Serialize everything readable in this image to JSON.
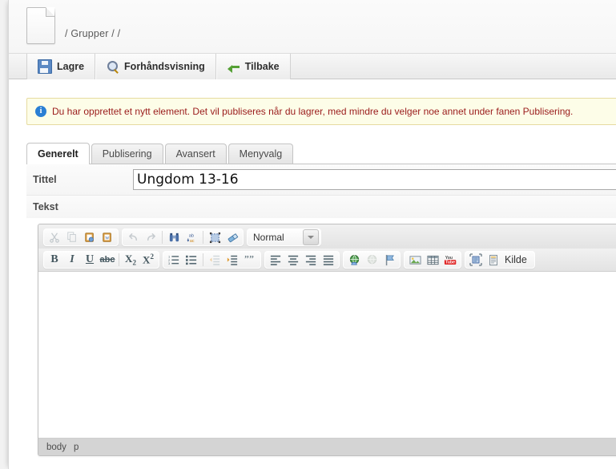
{
  "header": {
    "doc_icon": "page-document-icon",
    "breadcrumb": "/ Grupper / /"
  },
  "command_bar": {
    "buttons": [
      {
        "label": "Lagre",
        "icon": "floppy-disk-save-icon"
      },
      {
        "label": "Forhåndsvisning",
        "icon": "magnifier-preview-icon"
      },
      {
        "label": "Tilbake",
        "icon": "green-left-arrow-back-icon"
      }
    ]
  },
  "notification": {
    "icon": "info-circle-icon",
    "icon_glyph": "i",
    "text": "Du har opprettet et nytt element. Det vil publiseres når du lagrer, med mindre du velger noe annet under fanen Publisering.",
    "text_color": "#9a1b1b",
    "background": "#fdfde8",
    "border_color": "#e6dba0"
  },
  "tabs": [
    {
      "label": "Generelt",
      "active": true
    },
    {
      "label": "Publisering",
      "active": false
    },
    {
      "label": "Avansert",
      "active": false
    },
    {
      "label": "Menyvalg",
      "active": false
    }
  ],
  "form": {
    "title_field": {
      "label": "Tittel",
      "value": "Ungdom 13-16",
      "placeholder": ""
    },
    "text_field": {
      "label": "Tekst"
    }
  },
  "editor": {
    "toolbar_row1": [
      {
        "name": "cut",
        "icon": "scissors-cut-icon",
        "dim": true
      },
      {
        "name": "copy",
        "icon": "copy-icon",
        "dim": true
      },
      {
        "name": "paste",
        "icon": "paste-clipboard-icon",
        "dim": false
      },
      {
        "name": "paste-from-word",
        "icon": "paste-from-word-icon",
        "dim": false
      },
      {
        "name": "undo",
        "icon": "undo-arrow-icon",
        "dim": true
      },
      {
        "name": "redo",
        "icon": "redo-arrow-icon",
        "dim": true
      },
      {
        "name": "find",
        "icon": "binoculars-find-icon",
        "dim": false
      },
      {
        "name": "replace",
        "icon": "replace-abc-icon",
        "dim": false
      },
      {
        "name": "select-all",
        "icon": "select-all-icon",
        "dim": false
      },
      {
        "name": "remove-format",
        "icon": "eraser-remove-format-icon",
        "dim": false
      }
    ],
    "format_dropdown": {
      "name": "paragraph-format-dropdown",
      "value": "Normal"
    },
    "toolbar_row2": [
      {
        "name": "bold",
        "icon": "bold-icon",
        "glyph": "B"
      },
      {
        "name": "italic",
        "icon": "italic-icon",
        "glyph": "I"
      },
      {
        "name": "underline",
        "icon": "underline-icon",
        "glyph": "U"
      },
      {
        "name": "strikethrough",
        "icon": "strikethrough-icon",
        "glyph": "abc"
      },
      {
        "name": "subscript",
        "icon": "subscript-icon",
        "glyph": "X2"
      },
      {
        "name": "superscript",
        "icon": "superscript-icon",
        "glyph": "X2"
      },
      {
        "name": "numbered-list",
        "icon": "numbered-list-icon"
      },
      {
        "name": "bulleted-list",
        "icon": "bulleted-list-icon"
      },
      {
        "name": "outdent",
        "icon": "outdent-icon"
      },
      {
        "name": "indent",
        "icon": "indent-icon"
      },
      {
        "name": "blockquote",
        "icon": "blockquote-quotes-icon"
      },
      {
        "name": "align-left",
        "icon": "align-left-icon"
      },
      {
        "name": "align-center",
        "icon": "align-center-icon"
      },
      {
        "name": "align-right",
        "icon": "align-right-icon"
      },
      {
        "name": "justify",
        "icon": "justify-icon"
      },
      {
        "name": "link",
        "icon": "globe-link-icon"
      },
      {
        "name": "unlink",
        "icon": "globe-unlink-icon"
      },
      {
        "name": "anchor",
        "icon": "flag-anchor-icon"
      },
      {
        "name": "image",
        "icon": "image-picture-icon"
      },
      {
        "name": "table",
        "icon": "table-grid-icon"
      },
      {
        "name": "youtube",
        "icon": "youtube-icon"
      },
      {
        "name": "template",
        "icon": "template-widget-icon"
      },
      {
        "name": "source",
        "icon": "source-document-icon",
        "label": "Kilde"
      }
    ],
    "source_label": "Kilde",
    "youtube_top": "You",
    "youtube_bottom": "Tube",
    "content": "",
    "elements_path": [
      "body",
      "p"
    ]
  }
}
